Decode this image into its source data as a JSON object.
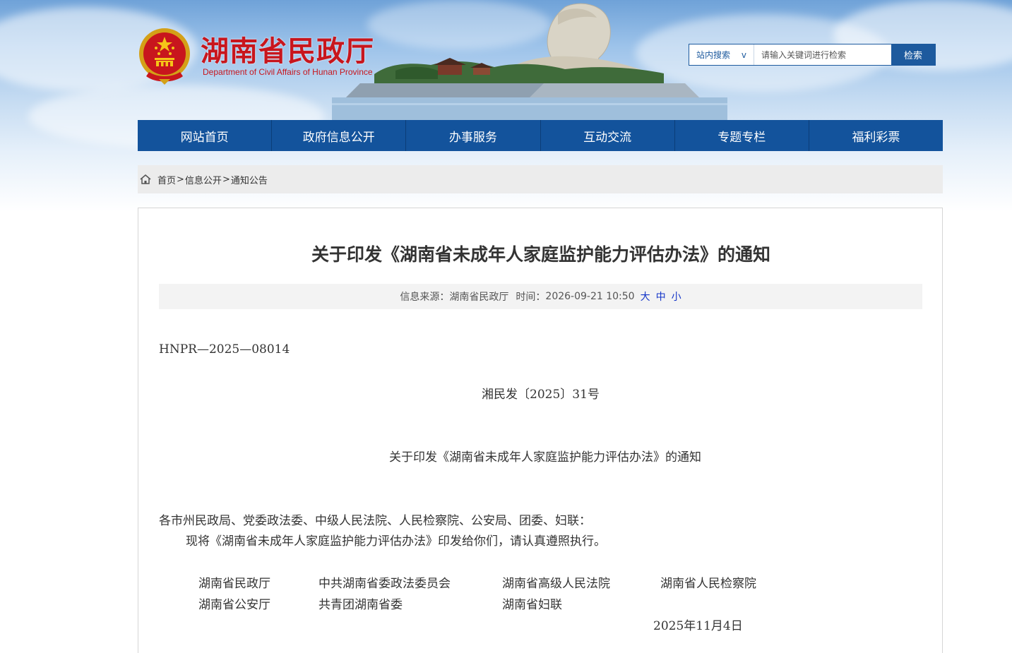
{
  "header": {
    "site_title": "湖南省民政厅",
    "site_subtitle": "Department of Civil Affairs of Hunan Province",
    "search": {
      "scope_label": "站内搜索",
      "scope_arrow": "v",
      "placeholder": "请输入关键词进行检索",
      "button_label": "检索"
    }
  },
  "nav": {
    "items": [
      {
        "label": "网站首页"
      },
      {
        "label": "政府信息公开"
      },
      {
        "label": "办事服务"
      },
      {
        "label": "互动交流"
      },
      {
        "label": "专题专栏"
      },
      {
        "label": "福利彩票"
      }
    ]
  },
  "breadcrumb": {
    "items": [
      "首页",
      "信息公开",
      "通知公告"
    ],
    "separator": ">"
  },
  "article": {
    "title": "关于印发《湖南省未成年人家庭监护能力评估办法》的通知",
    "meta": {
      "source_label": "信息来源：",
      "source": "湖南省民政厅",
      "time_label": "时间：",
      "time": "2026-09-21 10:50",
      "font_sizes": [
        "大",
        "中",
        "小"
      ]
    },
    "doc_code": "HNPR—2025—08014",
    "doc_number": "湘民发〔2025〕31号",
    "doc_heading": "关于印发《湖南省未成年人家庭监护能力评估办法》的通知",
    "addressee": "各市州民政局、党委政法委、中级人民法院、人民检察院、公安局、团委、妇联：",
    "paragraph": "现将《湖南省未成年人家庭监护能力评估办法》印发给你们，请认真遵照执行。",
    "signatories": {
      "row1": [
        "湖南省民政厅",
        "中共湖南省委政法委员会",
        "湖南省高级人民法院",
        "湖南省人民检察院"
      ],
      "row2": [
        "湖南省公安厅",
        "共青团湖南省委",
        "湖南省妇联"
      ]
    },
    "date": "2025年11月4日"
  },
  "colors": {
    "nav_blue": "#13539c",
    "title_red": "#c8161d",
    "link_blue": "#1435c8"
  }
}
